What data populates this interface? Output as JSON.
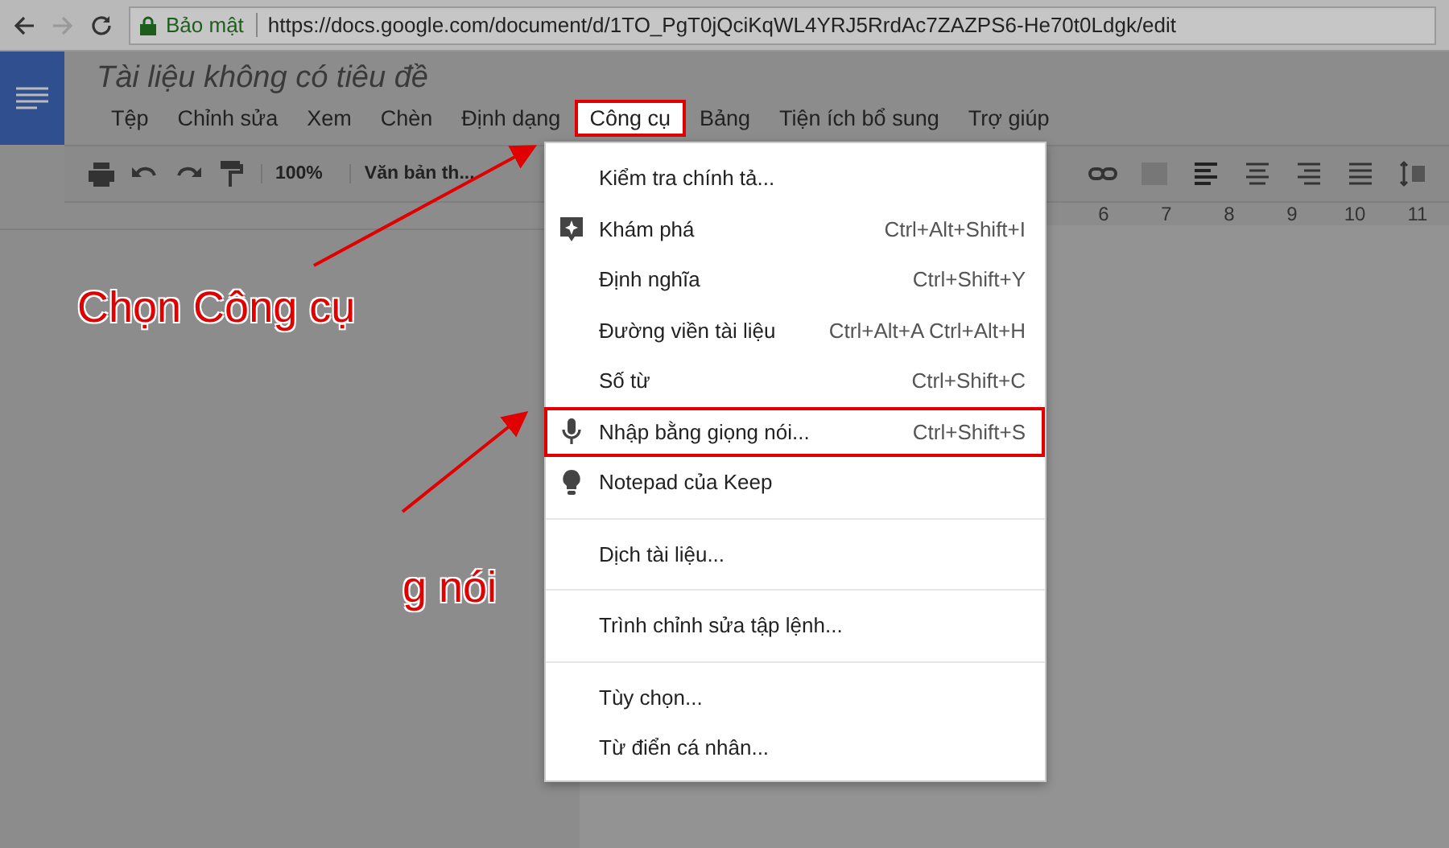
{
  "browser": {
    "secure_label": "Bảo mật",
    "url": "https://docs.google.com/document/d/1TO_PgT0jQciKqWL4YRJ5RrdAc7ZAZPS6-He70t0Ldgk/edit"
  },
  "document": {
    "title": "Tài liệu không có tiêu đề"
  },
  "menu_bar": [
    {
      "label": "Tệp",
      "selected": false
    },
    {
      "label": "Chỉnh sửa",
      "selected": false
    },
    {
      "label": "Xem",
      "selected": false
    },
    {
      "label": "Chèn",
      "selected": false
    },
    {
      "label": "Định dạng",
      "selected": false
    },
    {
      "label": "Công cụ",
      "selected": true
    },
    {
      "label": "Bảng",
      "selected": false
    },
    {
      "label": "Tiện ích bổ sung",
      "selected": false
    },
    {
      "label": "Trợ giúp",
      "selected": false
    }
  ],
  "toolbar": {
    "zoom": "100%",
    "style": "Văn bản th..."
  },
  "ruler": [
    "6",
    "7",
    "8",
    "9",
    "10",
    "11"
  ],
  "tools_menu": [
    [
      {
        "label": "Kiểm tra chính tả...",
        "kind": "plain",
        "highlighted": false
      },
      {
        "label": "Khám phá",
        "shortcut": "Ctrl+Alt+Shift+I",
        "kind": "explore",
        "highlighted": false
      },
      {
        "label": "Định nghĩa",
        "shortcut": "Ctrl+Shift+Y",
        "kind": "plain",
        "highlighted": false
      },
      {
        "label": "Đường viền tài liệu",
        "shortcut": "Ctrl+Alt+A Ctrl+Alt+H",
        "kind": "plain",
        "highlighted": false
      },
      {
        "label": "Số từ",
        "shortcut": "Ctrl+Shift+C",
        "kind": "plain",
        "highlighted": false
      },
      {
        "label": "Nhập bằng giọng nói...",
        "shortcut": "Ctrl+Shift+S",
        "kind": "voice",
        "highlighted": true
      },
      {
        "label": "Notepad của Keep",
        "kind": "keep",
        "highlighted": false
      }
    ],
    [
      {
        "label": "Dịch tài liệu...",
        "kind": "plain",
        "highlighted": false
      }
    ],
    [
      {
        "label": "Trình chỉnh sửa tập lệnh...",
        "kind": "plain",
        "highlighted": false
      }
    ],
    [
      {
        "label": "Tùy chọn...",
        "kind": "plain",
        "highlighted": false
      },
      {
        "label": "Từ điển cá nhân...",
        "kind": "plain",
        "highlighted": false
      }
    ]
  ],
  "annotations": [
    "Chọn Công cụ",
    "g nói"
  ]
}
